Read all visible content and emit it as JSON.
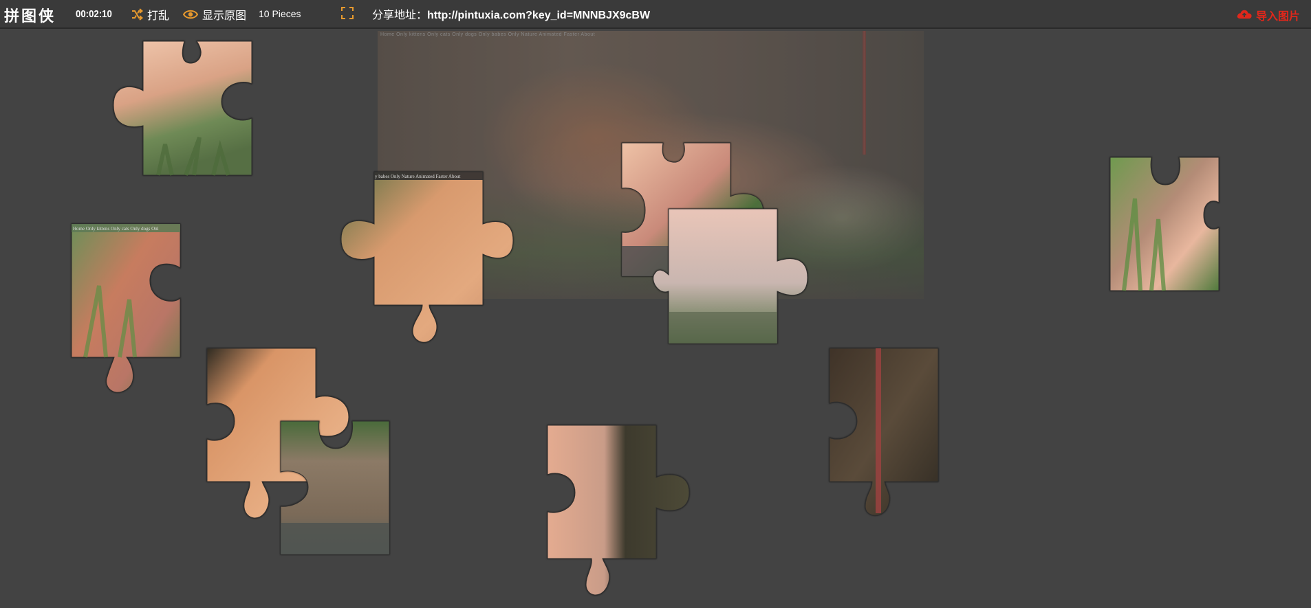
{
  "app": {
    "title": "拼图侠",
    "timer": "00:02:10",
    "shuffle_label": "打乱",
    "show_original_label": "显示原图",
    "pieces_label": "10 Pieces",
    "share_prefix": "分享地址：",
    "share_url": "http://pintuxia.com?key_id=MNNBJX9cBW",
    "import_label": "导入图片"
  },
  "board": {
    "ghost_nav_text": "Home   Only kittens   Only cats   Only dogs   Only babes   Only Nature   Animated   Faster   About"
  },
  "pieces": [
    {
      "label_text": ""
    },
    {
      "label_text": "Home  Only kittens  Only cats  Only dogs  Onl"
    },
    {
      "label_text": "y babes  Only Nature  Animated  Faster  About"
    },
    {
      "label_text": ""
    },
    {
      "label_text": ""
    },
    {
      "label_text": ""
    },
    {
      "label_text": ""
    },
    {
      "label_text": ""
    },
    {
      "label_text": ""
    },
    {
      "label_text": ""
    }
  ],
  "colors": {
    "background": "#434343",
    "toolbar": "#3a3a3a",
    "accent": "#e89a2e",
    "import": "#e0271b"
  }
}
